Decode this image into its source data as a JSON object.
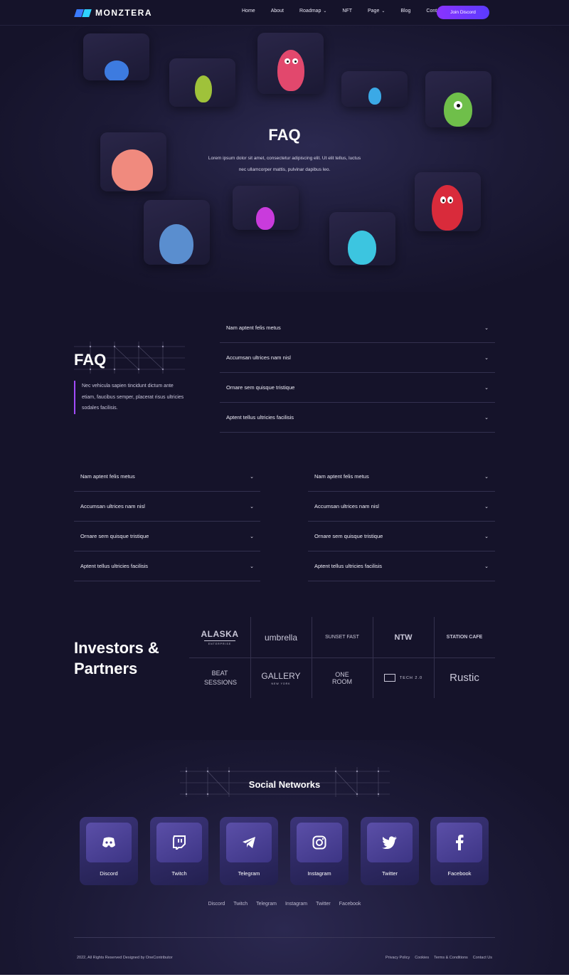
{
  "brand": {
    "name": "MONZTERA",
    "logo_colors": [
      "#3a7bff",
      "#2fd3ff"
    ]
  },
  "nav": {
    "items": [
      {
        "label": "Home",
        "dropdown": false
      },
      {
        "label": "About",
        "dropdown": false
      },
      {
        "label": "Roadmap",
        "dropdown": true
      },
      {
        "label": "NFT",
        "dropdown": false
      },
      {
        "label": "Page",
        "dropdown": true
      },
      {
        "label": "Blog",
        "dropdown": false
      },
      {
        "label": "Contact",
        "dropdown": false
      }
    ],
    "cta": "Join Discord"
  },
  "hero": {
    "title": "FAQ",
    "subtitle": "Lorem ipsum dolor sit amet, consectetur adipiscing elit. Ut elit tellus, luctus nec ullamcorper mattis, pulvinar dapibus leo."
  },
  "faq": {
    "heading": "FAQ",
    "description": "Nec vehicula sapien tincidunt dictum ante etiam, faucibus semper, placerat risus ultricies sodales facilisis.",
    "items": [
      "Nam aptent felis metus",
      "Accumsan ultrices nam nisl",
      "Ornare sem quisque tristique",
      "Aptent tellus ultricies facilisis"
    ],
    "left_items": [
      "Nam aptent felis metus",
      "Accumsan ultrices nam nisl",
      "Ornare sem quisque tristique",
      "Aptent tellus ultricies facilisis"
    ],
    "right_items": [
      "Nam aptent felis metus",
      "Accumsan ultrices nam nisl",
      "Ornare sem quisque tristique",
      "Aptent tellus ultricies facilisis"
    ]
  },
  "investors": {
    "title_line1": "Investors &",
    "title_line2": "Partners",
    "logos": [
      {
        "name": "ALASKA",
        "sub": "ENTERPRISE"
      },
      {
        "name": "umbrella",
        "sub": ""
      },
      {
        "name": "SUNSET FAST",
        "sub": ""
      },
      {
        "name": "NTW",
        "sub": ""
      },
      {
        "name": "STATION CAFE",
        "sub": ""
      },
      {
        "name": "BEAT SESSIONS",
        "sub": ""
      },
      {
        "name": "GALLERY",
        "sub": "NEW YORK"
      },
      {
        "name": "ONE ROOM",
        "sub": ""
      },
      {
        "name": "TECH 2.0",
        "sub": ""
      },
      {
        "name": "Rustic",
        "sub": ""
      }
    ]
  },
  "social": {
    "title": "Social Networks",
    "cards": [
      {
        "label": "Discord",
        "icon": "discord-icon"
      },
      {
        "label": "Twitch",
        "icon": "twitch-icon"
      },
      {
        "label": "Telegram",
        "icon": "telegram-icon"
      },
      {
        "label": "Instagram",
        "icon": "instagram-icon"
      },
      {
        "label": "Twitter",
        "icon": "twitter-icon"
      },
      {
        "label": "Facebook",
        "icon": "facebook-icon"
      }
    ],
    "links": [
      "Discord",
      "Twitch",
      "Telegram",
      "Instagram",
      "Twitter",
      "Facebook"
    ]
  },
  "footer": {
    "copyright": "2022, All Rights Reserved Designed by OneContributor",
    "links": [
      "Privacy Policy",
      "Cookies",
      "Terms & Conditions",
      "Contact Us"
    ]
  }
}
